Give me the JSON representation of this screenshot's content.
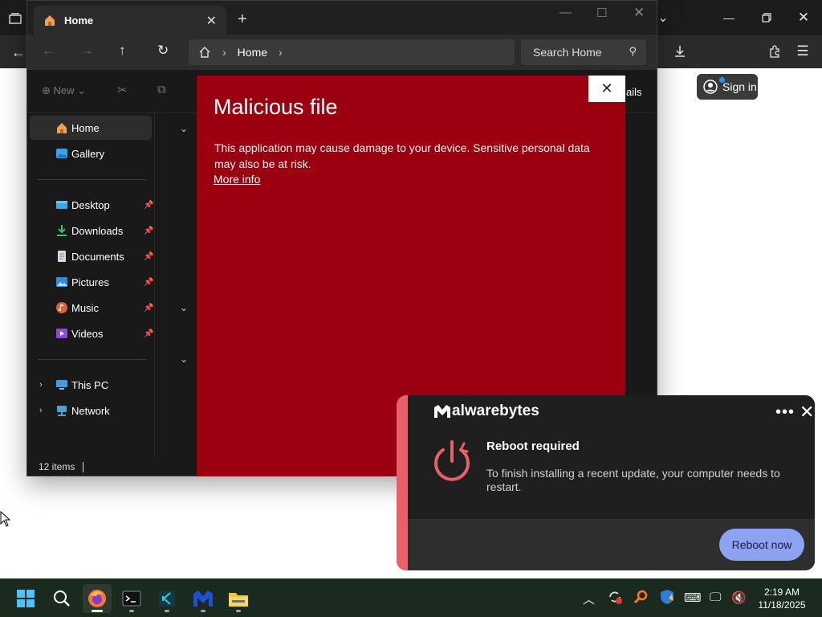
{
  "browser": {
    "signin_label": "Sign in"
  },
  "explorer": {
    "tab_title": "Home",
    "breadcrumb": [
      "Home"
    ],
    "search_placeholder": "Search Home",
    "cmd_new_label": "New",
    "details_fragment": "ails",
    "sidebar": {
      "top": [
        {
          "label": "Home",
          "icon": "home-icon",
          "selected": true
        },
        {
          "label": "Gallery",
          "icon": "gallery-icon"
        }
      ],
      "pinned": [
        {
          "label": "Desktop",
          "icon": "desktop-icon"
        },
        {
          "label": "Downloads",
          "icon": "downloads-icon"
        },
        {
          "label": "Documents",
          "icon": "documents-icon"
        },
        {
          "label": "Pictures",
          "icon": "pictures-icon"
        },
        {
          "label": "Music",
          "icon": "music-icon"
        },
        {
          "label": "Videos",
          "icon": "videos-icon"
        }
      ],
      "bottom": [
        {
          "label": "This PC",
          "icon": "pc-icon"
        },
        {
          "label": "Network",
          "icon": "network-icon"
        }
      ]
    },
    "status_items": "12 items"
  },
  "malicious_popup": {
    "title": "Malicious file",
    "message": "This application may cause damage to your device. Sensitive personal data may also be at risk.",
    "link": "More info",
    "bg_color": "#9b0010"
  },
  "toast": {
    "brand": "alwarebytes",
    "title": "Reboot required",
    "body": "To finish installing a recent update, your computer needs to restart.",
    "button": "Reboot now",
    "accent_color": "#e8606a",
    "button_color": "#8da2f0"
  },
  "taskbar": {
    "apps": [
      "start-icon",
      "search-icon",
      "firefox-icon",
      "terminal-icon",
      "code-icon",
      "malwarebytes-icon",
      "file-explorer-icon"
    ],
    "clock_time": "2:19 AM",
    "clock_date": "11/18/2025"
  }
}
